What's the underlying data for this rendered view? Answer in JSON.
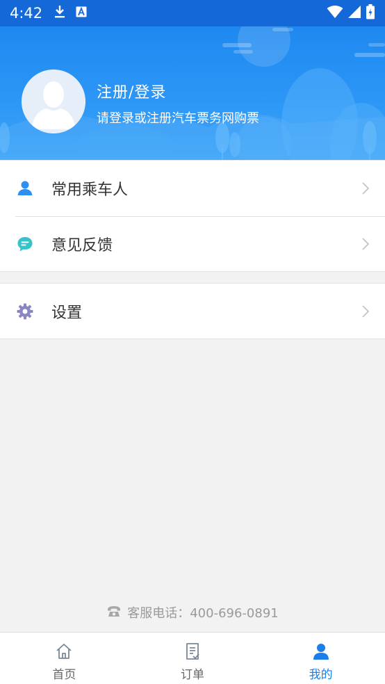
{
  "status_bar": {
    "time": "4:42",
    "icons": [
      "download-icon",
      "keyboard-a-icon",
      "wifi-icon",
      "signal-icon",
      "battery-icon"
    ]
  },
  "header": {
    "title": "注册/登录",
    "subtitle": "请登录或注册汽车票务网购票"
  },
  "menu": {
    "group1": [
      {
        "label": "常用乘车人",
        "icon": "passenger-icon",
        "icon_color": "#2d8ff0"
      },
      {
        "label": "意见反馈",
        "icon": "feedback-icon",
        "icon_color": "#36c3c9"
      }
    ],
    "group2": [
      {
        "label": "设置",
        "icon": "gear-icon",
        "icon_color": "#8a86c2"
      }
    ]
  },
  "footer": {
    "hotline": "客服电话：400-696-0891"
  },
  "tabs": [
    {
      "label": "首页",
      "icon": "home-icon",
      "active": false
    },
    {
      "label": "订单",
      "icon": "order-icon",
      "active": false
    },
    {
      "label": "我的",
      "icon": "profile-icon",
      "active": true
    }
  ],
  "colors": {
    "accent": "#1a7fe8",
    "header_top": "#1e88f0",
    "background": "#f2f2f2"
  }
}
